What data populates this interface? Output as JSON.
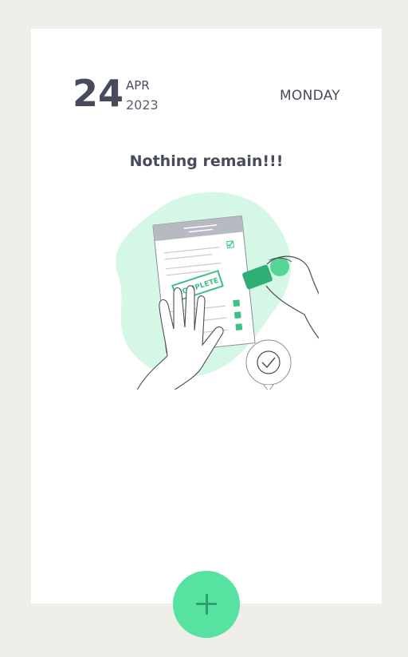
{
  "header": {
    "day": "24",
    "month": "APR",
    "year": "2023",
    "weekday": "MONDAY"
  },
  "empty_state": {
    "message": "Nothing remain!!!",
    "illustration": "checklist-complete-stamp-illustration",
    "stamp_text": "COMPLETE"
  },
  "fab": {
    "icon": "plus-icon",
    "color": "#56e3a1"
  },
  "colors": {
    "background": "#efeee9",
    "card": "#ffffff",
    "text": "#474b5b",
    "accent": "#56e3a1",
    "accent_dark": "#2c9f6b",
    "blob": "#d4f7e6"
  }
}
